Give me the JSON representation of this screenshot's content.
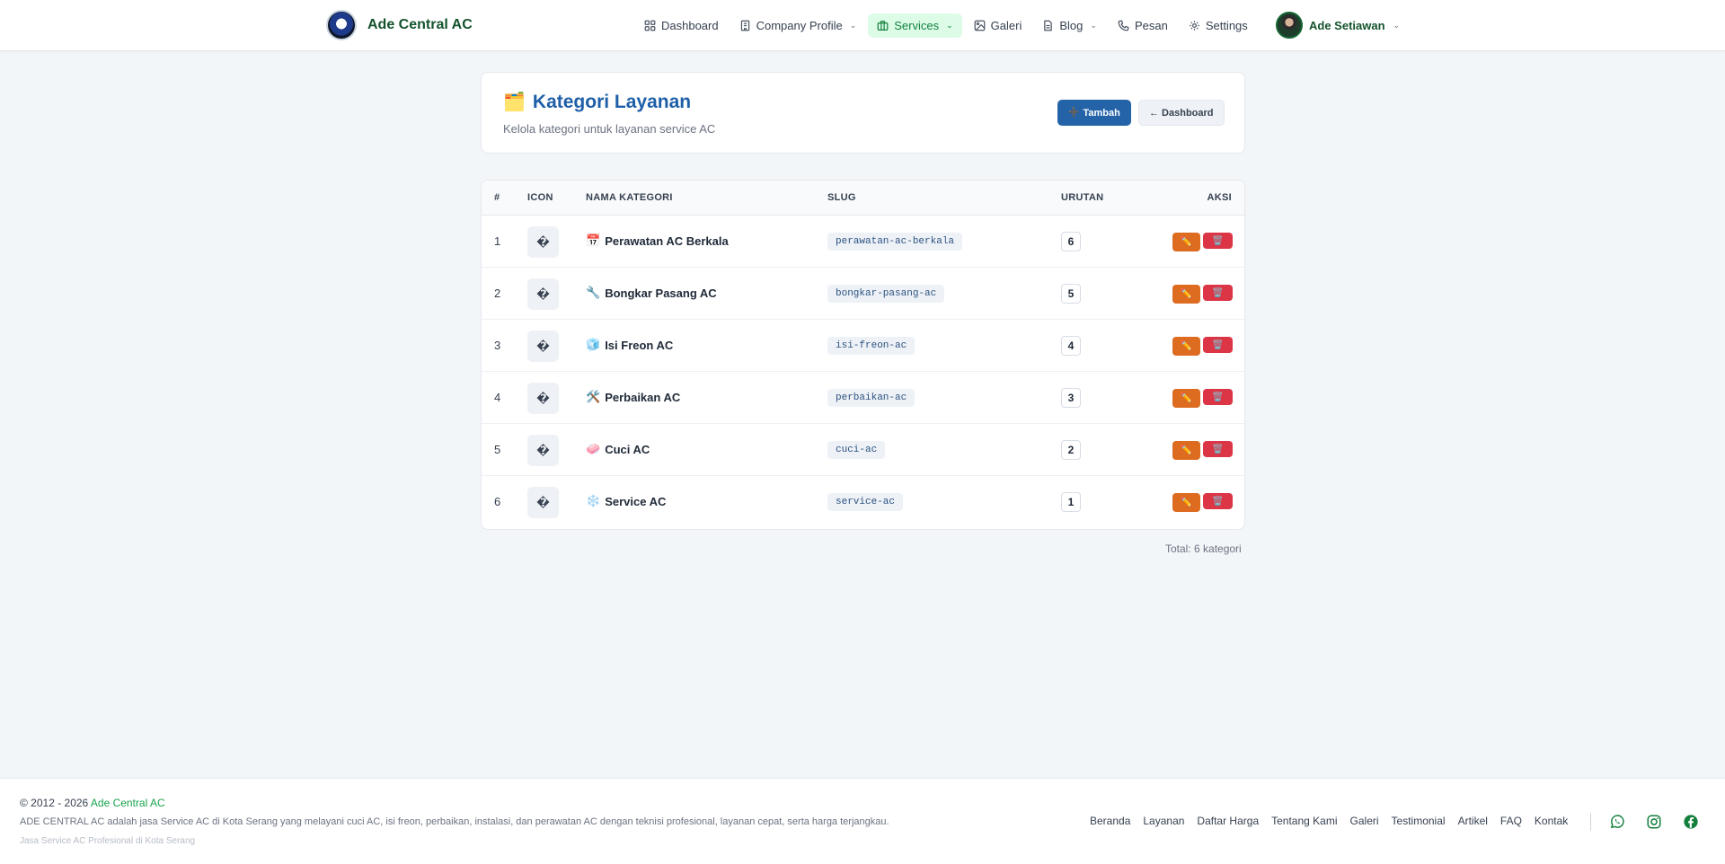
{
  "brand": {
    "name": "Ade Central AC"
  },
  "nav": [
    {
      "label": "Dashboard",
      "icon": "grid-icon",
      "dropdown": false,
      "active": false
    },
    {
      "label": "Company Profile",
      "icon": "building-icon",
      "dropdown": true,
      "active": false
    },
    {
      "label": "Services",
      "icon": "briefcase-icon",
      "dropdown": true,
      "active": true
    },
    {
      "label": "Galeri",
      "icon": "image-icon",
      "dropdown": false,
      "active": false
    },
    {
      "label": "Blog",
      "icon": "document-icon",
      "dropdown": true,
      "active": false
    },
    {
      "label": "Pesan",
      "icon": "phone-icon",
      "dropdown": false,
      "active": false
    },
    {
      "label": "Settings",
      "icon": "gear-icon",
      "dropdown": false,
      "active": false
    }
  ],
  "user": {
    "name": "Ade Setiawan"
  },
  "header": {
    "emoji": "🗂️",
    "title": "Kategori Layanan",
    "subtitle": "Kelola kategori untuk layanan service AC",
    "add_label": "Tambah",
    "add_icon": "➕",
    "back_label": "← Dashboard"
  },
  "table": {
    "columns": {
      "no": "#",
      "icon": "ICON",
      "name": "NAMA KATEGORI",
      "slug": "SLUG",
      "order": "URUTAN",
      "action": "AKSI"
    },
    "rows": [
      {
        "no": "1",
        "icon": "�",
        "emoji": "📅",
        "name": "Perawatan AC Berkala",
        "slug": "perawatan-ac-berkala",
        "order": "6"
      },
      {
        "no": "2",
        "icon": "�",
        "emoji": "🔧",
        "name": "Bongkar Pasang AC",
        "slug": "bongkar-pasang-ac",
        "order": "5"
      },
      {
        "no": "3",
        "icon": "�",
        "emoji": "🧊",
        "name": "Isi Freon AC",
        "slug": "isi-freon-ac",
        "order": "4"
      },
      {
        "no": "4",
        "icon": "�",
        "emoji": "🛠️",
        "name": "Perbaikan AC",
        "slug": "perbaikan-ac",
        "order": "3"
      },
      {
        "no": "5",
        "icon": "�",
        "emoji": "🧼",
        "name": "Cuci AC",
        "slug": "cuci-ac",
        "order": "2"
      },
      {
        "no": "6",
        "icon": "�",
        "emoji": "❄️",
        "name": "Service AC",
        "slug": "service-ac",
        "order": "1"
      }
    ],
    "edit_icon": "✏️",
    "delete_icon": "🗑️"
  },
  "total": "Total: 6 kategori",
  "footer": {
    "copyright_prefix": "© 2012 - 2026",
    "copyright_brand": "Ade Central AC",
    "description": "ADE CENTRAL AC adalah jasa Service AC di Kota Serang yang melayani cuci AC, isi freon, perbaikan, instalasi, dan perawatan AC dengan teknisi profesional, layanan cepat, serta harga terjangkau.",
    "tagline": "Jasa Service AC Profesional di Kota Serang",
    "links": [
      "Beranda",
      "Layanan",
      "Daftar Harga",
      "Tentang Kami",
      "Galeri",
      "Testimonial",
      "Artikel",
      "FAQ",
      "Kontak"
    ],
    "social": [
      "whatsapp-icon",
      "instagram-icon",
      "facebook-icon"
    ]
  },
  "colors": {
    "brand_green": "#16a34a",
    "primary_blue": "#2563a8",
    "edit_orange": "#dd6b20",
    "delete_red": "#dc3545"
  }
}
